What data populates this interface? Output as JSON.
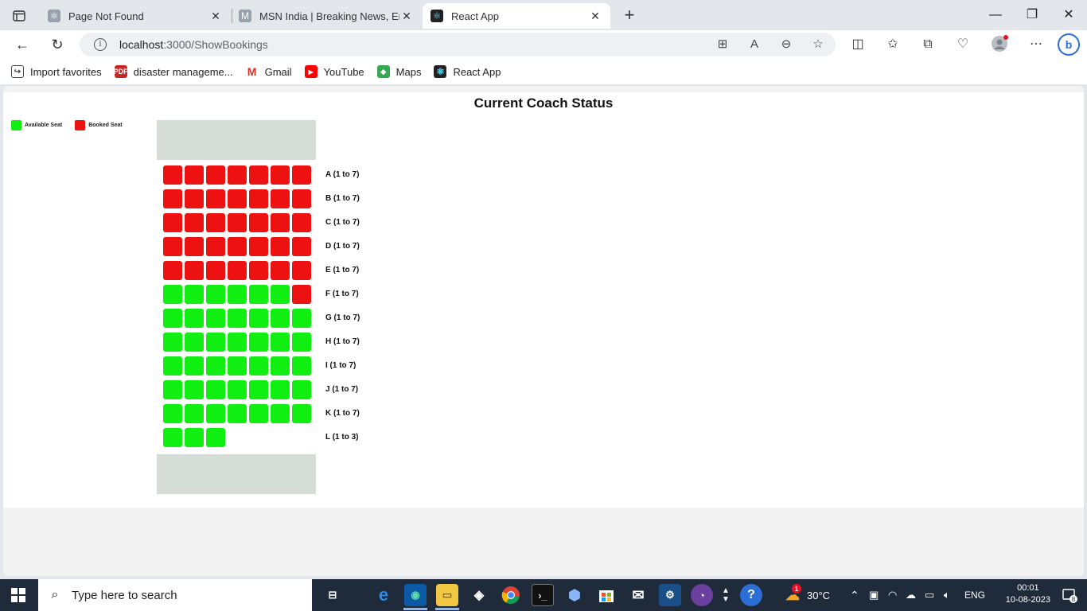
{
  "browser": {
    "tabs": [
      {
        "label": "Page Not Found",
        "icon": "react-icon-grey"
      },
      {
        "label": "MSN India | Breaking News, Ente",
        "icon": "msn-icon"
      },
      {
        "label": "React App",
        "icon": "react-icon"
      }
    ],
    "url_host": "localhost",
    "url_path": ":3000/ShowBookings",
    "favorites": [
      {
        "label": "Import favorites",
        "icon": "import-icon"
      },
      {
        "label": "disaster manageme...",
        "icon": "pdf-icon"
      },
      {
        "label": "Gmail",
        "icon": "gmail-icon"
      },
      {
        "label": "YouTube",
        "icon": "youtube-icon"
      },
      {
        "label": "Maps",
        "icon": "maps-icon"
      },
      {
        "label": "React App",
        "icon": "react-icon"
      }
    ]
  },
  "page": {
    "title": "Current Coach Status",
    "legend": {
      "available": "Available Seat",
      "booked": "Booked Seat",
      "available_color": "#11ee11",
      "booked_color": "#ee1111"
    },
    "rows": [
      {
        "label": "A (1 to 7)",
        "seats": [
          "b",
          "b",
          "b",
          "b",
          "b",
          "b",
          "b"
        ]
      },
      {
        "label": "B (1 to 7)",
        "seats": [
          "b",
          "b",
          "b",
          "b",
          "b",
          "b",
          "b"
        ]
      },
      {
        "label": "C (1 to 7)",
        "seats": [
          "b",
          "b",
          "b",
          "b",
          "b",
          "b",
          "b"
        ]
      },
      {
        "label": "D (1 to 7)",
        "seats": [
          "b",
          "b",
          "b",
          "b",
          "b",
          "b",
          "b"
        ]
      },
      {
        "label": "E (1 to 7)",
        "seats": [
          "b",
          "b",
          "b",
          "b",
          "b",
          "b",
          "b"
        ]
      },
      {
        "label": "F (1 to 7)",
        "seats": [
          "a",
          "a",
          "a",
          "a",
          "a",
          "a",
          "b"
        ]
      },
      {
        "label": "G (1 to 7)",
        "seats": [
          "a",
          "a",
          "a",
          "a",
          "a",
          "a",
          "a"
        ]
      },
      {
        "label": "H (1 to 7)",
        "seats": [
          "a",
          "a",
          "a",
          "a",
          "a",
          "a",
          "a"
        ]
      },
      {
        "label": "I (1 to 7)",
        "seats": [
          "a",
          "a",
          "a",
          "a",
          "a",
          "a",
          "a"
        ]
      },
      {
        "label": "J (1 to 7)",
        "seats": [
          "a",
          "a",
          "a",
          "a",
          "a",
          "a",
          "a"
        ]
      },
      {
        "label": "K (1 to 7)",
        "seats": [
          "a",
          "a",
          "a",
          "a",
          "a",
          "a",
          "a"
        ]
      },
      {
        "label": "L (1 to 3)",
        "seats": [
          "a",
          "a",
          "a"
        ]
      }
    ]
  },
  "taskbar": {
    "search_placeholder": "Type here to search",
    "temperature": "30°C",
    "language": "ENG",
    "time": "00:01",
    "date": "10-08-2023",
    "notification_count": "8",
    "weather_badge": "1"
  }
}
